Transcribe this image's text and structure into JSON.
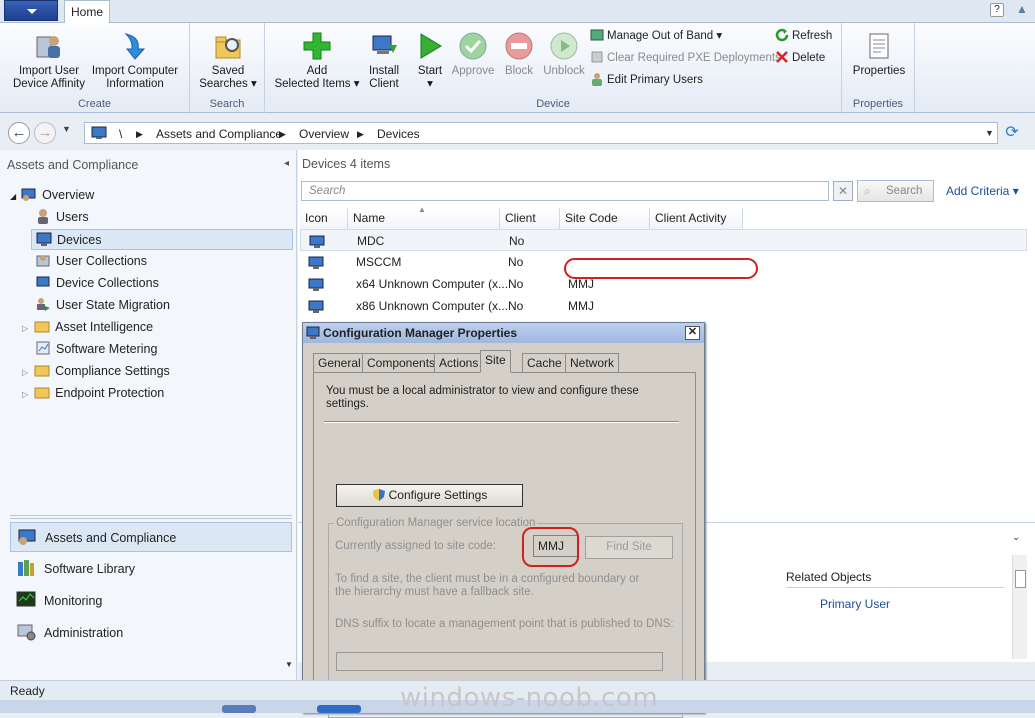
{
  "ribbon": {
    "tab": "Home",
    "help": "?",
    "groups": {
      "create": {
        "label": "Create",
        "import_affinity": "Import User\nDevice Affinity",
        "import_computer": "Import Computer\nInformation"
      },
      "search": {
        "label": "Search",
        "saved_searches": "Saved\nSearches ▾"
      },
      "device": {
        "label": "Device",
        "add_selected": "Add\nSelected Items ▾",
        "install_client": "Install\nClient",
        "start": "Start\n▾",
        "approve": "Approve",
        "block": "Block",
        "unblock": "Unblock",
        "manage_oob": "Manage Out of Band ▾",
        "clear_pxe": "Clear Required PXE Deployments",
        "edit_primary": "Edit Primary Users",
        "refresh": "Refresh",
        "delete": "Delete"
      },
      "properties": {
        "label": "Properties",
        "properties_btn": "Properties"
      }
    }
  },
  "address": {
    "root": "\\",
    "crumbs": [
      "Assets and Compliance",
      "Overview",
      "Devices"
    ]
  },
  "nav": {
    "title": "Assets and Compliance",
    "tree": [
      {
        "label": "Overview"
      },
      {
        "label": "Users"
      },
      {
        "label": "Devices"
      },
      {
        "label": "User Collections"
      },
      {
        "label": "Device Collections"
      },
      {
        "label": "User State Migration"
      },
      {
        "label": "Asset Intelligence"
      },
      {
        "label": "Software Metering"
      },
      {
        "label": "Compliance Settings"
      },
      {
        "label": "Endpoint Protection"
      }
    ],
    "workspaces": [
      {
        "label": "Assets and Compliance"
      },
      {
        "label": "Software Library"
      },
      {
        "label": "Monitoring"
      },
      {
        "label": "Administration"
      }
    ]
  },
  "list": {
    "title": "Devices 4 items",
    "search_placeholder": "Search",
    "search_button": "Search",
    "add_criteria": "Add Criteria ▾",
    "columns": [
      "Icon",
      "Name",
      "Client",
      "Site Code",
      "Client Activity"
    ],
    "rows": [
      {
        "name": "MDC",
        "client": "No",
        "site": ""
      },
      {
        "name": "MSCCM",
        "client": "No",
        "site": ""
      },
      {
        "name": "x64 Unknown Computer (x...",
        "client": "No",
        "site": "MMJ"
      },
      {
        "name": "x86 Unknown Computer (x...",
        "client": "No",
        "site": "MMJ"
      }
    ]
  },
  "detail": {
    "related_objects": "Related Objects",
    "primary_user": "Primary User"
  },
  "dialog": {
    "title": "Configuration Manager Properties",
    "close": "✕",
    "tabs": [
      "General",
      "Components",
      "Actions",
      "Site",
      "Cache",
      "Network"
    ],
    "admin_note": "You must be a local administrator to view and configure these settings.",
    "configure_button": "Configure Settings",
    "group_label": "Configuration Manager service location",
    "assigned_label": "Currently assigned to site code:",
    "site_code": "MMJ",
    "find_site": "Find Site",
    "find_note": "To find a site, the client must be in a configured boundary or the hierarchy must have a fallback site.",
    "dns_label": "DNS suffix to locate a management point that is published to DNS:"
  },
  "status": "Ready",
  "watermark": "windows-noob.com"
}
